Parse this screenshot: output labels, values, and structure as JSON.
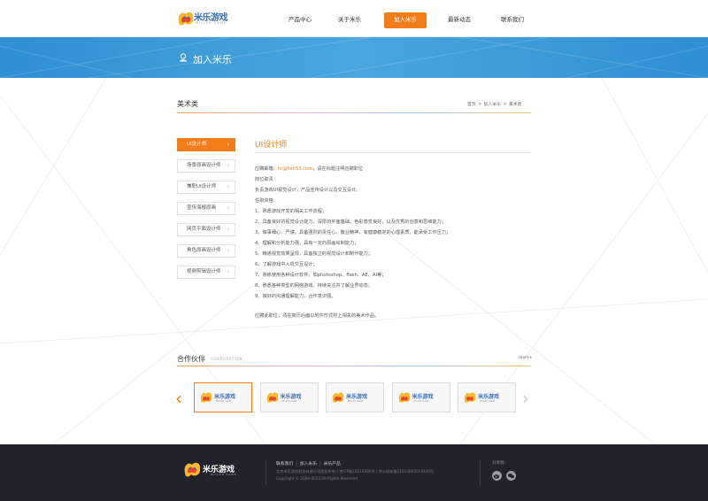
{
  "brand": {
    "name": "米乐游戏",
    "sub": "MILLER GAME"
  },
  "nav": {
    "items": [
      {
        "label": "产品中心"
      },
      {
        "label": "关于米乐"
      },
      {
        "label": "加入米乐"
      },
      {
        "label": "最新动态"
      },
      {
        "label": "联系我们"
      }
    ],
    "active_index": 2
  },
  "banner": {
    "title": "加入米乐",
    "icon": "user-icon"
  },
  "section": {
    "title": "美术类",
    "breadcrumb": [
      "首页",
      ">",
      "加入米乐",
      ">",
      "美术类"
    ]
  },
  "sidebar": {
    "items": [
      {
        "label": "UI设计师"
      },
      {
        "label": "场景原画设计师"
      },
      {
        "label": "兼职UI设计师"
      },
      {
        "label": "宣传海报原画"
      },
      {
        "label": "网页平面设计师"
      },
      {
        "label": "角色原画设计师"
      },
      {
        "label": "视频剪辑设计师"
      }
    ],
    "active_index": 0
  },
  "job": {
    "title": "UI设计师",
    "email_label": "应聘邮箱：",
    "email": "hr@fish53.com",
    "email_note": "，请在标题注明应聘职位",
    "duty_heading": "岗位职责：",
    "duty": "负责游戏UI视觉设计，产品宣传设计以及交互设计。",
    "req_heading": "任职资格：",
    "requirements": [
      "1、熟悉游戏开发的相关工作流程；",
      "2、具备良好的视觉设计能力，深厚的平面基础，色彩感觉良好，以及优秀的创意和思维能力；",
      "3、做事细心、严谨，具备强烈的责任心、敬业精神，有健康稳定的心理素质，能承受工作压力；",
      "4、理解和分析能力强，具有一定的原画绘制能力；",
      "5、精通视觉效果呈现，具备独立的视觉设计和制作能力；",
      "6、了解游戏中人机交互设计；",
      "7、熟练使用各种设计软件，如photoshop、flash、AE、AI等；",
      "8、熟悉各种类型的网络游戏，持续关注并了解业界动态；",
      "9、良好的沟通理解能力，合作意识强。"
    ],
    "closing": "应聘此职位，须在简历后面以附件形式附上相关的美术作品。"
  },
  "partners": {
    "title": "合作伙伴",
    "en": "CORPORATION",
    "more": "more+",
    "count": 5,
    "active_index": 0,
    "prev_icon": "chevron-left-icon",
    "next_icon": "chevron-right-icon"
  },
  "footer": {
    "links": [
      "联系我们",
      "加入米乐",
      "米乐产品"
    ],
    "company": "北京米乐游戏科技有限公司版权所有",
    "icp": "京ICP备10216680号",
    "police": "京公网安备11010802014440号",
    "copyright": "Copyright © 2009-2015 All Rights Reserved",
    "share_label": "分享到：",
    "share_icons": [
      "weibo-icon",
      "wechat-icon"
    ]
  },
  "colors": {
    "accent": "#f07d1a",
    "banner": "#3a9ad8",
    "footer": "#22232a"
  }
}
